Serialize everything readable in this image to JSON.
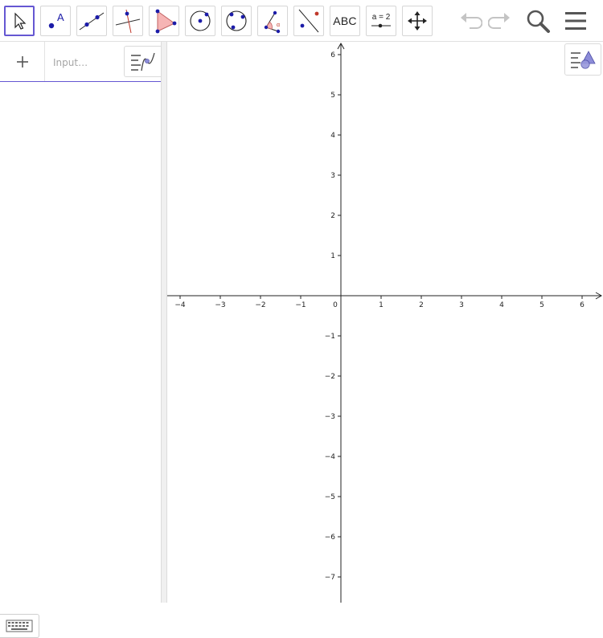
{
  "toolbar": {
    "tools": [
      {
        "name": "move-tool",
        "icon": "cursor-arrow-icon",
        "selected": true
      },
      {
        "name": "point-tool",
        "icon": "point-icon"
      },
      {
        "name": "line-tool",
        "icon": "line-through-two-points-icon"
      },
      {
        "name": "perpendicular-line-tool",
        "icon": "perpendicular-line-icon"
      },
      {
        "name": "polygon-tool",
        "icon": "polygon-icon"
      },
      {
        "name": "circle-tool",
        "icon": "circle-center-point-icon"
      },
      {
        "name": "circle-three-points-tool",
        "icon": "circle-three-points-icon"
      },
      {
        "name": "angle-tool",
        "icon": "angle-icon"
      },
      {
        "name": "reflect-tool",
        "icon": "reflect-about-line-icon"
      },
      {
        "name": "text-tool",
        "label": "ABC"
      },
      {
        "name": "slider-tool",
        "label": "a = 2"
      },
      {
        "name": "move-graphics-view-tool",
        "icon": "move-arrows-icon"
      }
    ],
    "undo_icon": "undo-icon",
    "redo_icon": "redo-icon",
    "search_icon": "search-icon",
    "menu_icon": "hamburger-menu-icon"
  },
  "algebra": {
    "add_icon": "plus-icon",
    "input_placeholder": "Input…",
    "style_icon": "algebra-style-icon",
    "keyboard_icon": "keyboard-icon"
  },
  "graphics": {
    "style_icon": "graphics-style-icon",
    "x_ticks": [
      "−4",
      "−3",
      "−2",
      "−1",
      "0",
      "1",
      "2",
      "3",
      "4",
      "5",
      "6"
    ],
    "y_ticks_positive": [
      "6",
      "5",
      "4",
      "3",
      "2",
      "1"
    ],
    "y_ticks_negative": [
      "−1",
      "−2",
      "−3",
      "−4",
      "−5",
      "−6",
      "−7"
    ],
    "accent": "#6557d2"
  }
}
